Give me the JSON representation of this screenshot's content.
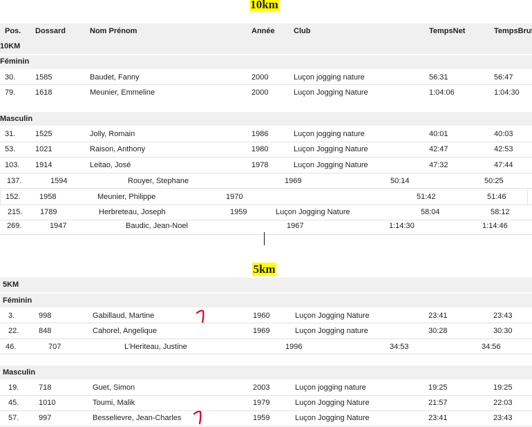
{
  "sections": {
    "s10km": {
      "title": "10km"
    },
    "s5km": {
      "title": "5km"
    }
  },
  "header": {
    "pos": "Pos.",
    "dossard": "Dossard",
    "nom": "Nom Prénom",
    "annee": "Année",
    "club": "Club",
    "tempsnet": "TempsNet",
    "tempsbrut": "TempsBrut"
  },
  "t10": {
    "distance": "10KM",
    "f_label": "Féminin",
    "m_label": "Masculin",
    "rows": [
      {
        "pos": "30.",
        "dossard": "1585",
        "nom": "Baudet, Fanny",
        "annee": "2000",
        "club": "Luçon jogging nature",
        "net": "56:31",
        "brut": "56:47"
      },
      {
        "pos": "79.",
        "dossard": "1618",
        "nom": "Meunier, Emmeline",
        "annee": "2000",
        "club": "Luçon Jogging Nature",
        "net": "1:04:06",
        "brut": "1:04:30"
      },
      {
        "pos": "31.",
        "dossard": "1525",
        "nom": "Jolly, Romain",
        "annee": "1986",
        "club": "Luçon jogging nature",
        "net": "40:01",
        "brut": "40:03"
      },
      {
        "pos": "53.",
        "dossard": "1021",
        "nom": "Raison, Anthony",
        "annee": "1980",
        "club": "Luçon Jogging Nature",
        "net": "42:47",
        "brut": "42:53"
      },
      {
        "pos": "103.",
        "dossard": "1914",
        "nom": "Leitao, José",
        "annee": "1978",
        "club": "Luçon Jogging Nature",
        "net": "47:32",
        "brut": "47:44"
      },
      {
        "pos": "137.",
        "dossard": "1594",
        "nom": "Rouyer, Stephane",
        "annee": "1969",
        "club": "",
        "net": "50:14",
        "brut": "50:25"
      },
      {
        "pos": "152.",
        "dossard": "1958",
        "nom": "Meunier, Philippe",
        "annee": "1970",
        "club": "",
        "net": "51:42",
        "brut": "51:46"
      },
      {
        "pos": "215.",
        "dossard": "1789",
        "nom": "Herbreteau, Joseph",
        "annee": "1959",
        "club": "Luçon Jogging Nature",
        "net": "58:04",
        "brut": "58:12"
      },
      {
        "pos": "269.",
        "dossard": "1947",
        "nom": "Baudic, Jean-Noel",
        "annee": "1967",
        "club": "",
        "net": "1:14:30",
        "brut": "1:14:46"
      }
    ]
  },
  "t5": {
    "distance": "5KM",
    "f_label": "Féminin",
    "m_label": "Masculin",
    "rows": [
      {
        "pos": "3.",
        "dossard": "998",
        "nom": "Gabillaud, Martine",
        "annee": "1960",
        "club": "Luçon Jogging Nature",
        "net": "23:41",
        "brut": "23:43"
      },
      {
        "pos": "22.",
        "dossard": "848",
        "nom": "Cahorel, Angelique",
        "annee": "1969",
        "club": "Luçon Jogging nature",
        "net": "30:28",
        "brut": "30:30"
      },
      {
        "pos": "46.",
        "dossard": "707",
        "nom": "L'Heriteau, Justine",
        "annee": "1996",
        "club": "",
        "net": "34:53",
        "brut": "34:56"
      },
      {
        "pos": "19.",
        "dossard": "718",
        "nom": "Guet, Simon",
        "annee": "2003",
        "club": "Luçon jogging nature",
        "net": "19:25",
        "brut": "19:25"
      },
      {
        "pos": "45.",
        "dossard": "1010",
        "nom": "Toumi, Malik",
        "annee": "1979",
        "club": "Luçon Jogging Nature",
        "net": "21:57",
        "brut": "22:03"
      },
      {
        "pos": "57.",
        "dossard": "997",
        "nom": "Besselievre, Jean-Charles",
        "annee": "1959",
        "club": "Luçon Jogging Nature",
        "net": "23:41",
        "brut": "23:43"
      }
    ]
  },
  "colors": {
    "highlight": "#ffff00",
    "band": "#f0f0f0",
    "red_mark": "#e0001a"
  }
}
